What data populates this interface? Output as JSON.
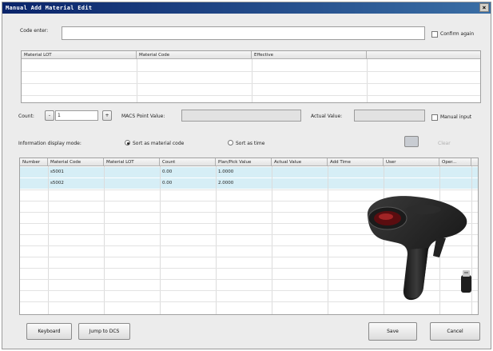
{
  "window": {
    "title": "Manual Add Material Edit",
    "close_glyph": "×"
  },
  "code_entry": {
    "label": "Code enter:",
    "value": "",
    "confirm_label": "Confirm again"
  },
  "top_table": {
    "columns": [
      "Material LOT",
      "Material Code",
      "Effective",
      ""
    ]
  },
  "count": {
    "label": "Count:",
    "minus": "-",
    "value": "1",
    "plus": "+"
  },
  "macs": {
    "label": "MACS Point Value:",
    "value": ""
  },
  "actual": {
    "label": "Actual Value:",
    "value": "",
    "manual_label": "Manual input"
  },
  "display_mode": {
    "label": "Information display mode:",
    "options": [
      "Sort as material code",
      "Sort as time"
    ],
    "selected": 0,
    "clear_label": "Clear"
  },
  "main_table": {
    "columns": [
      "Number",
      "Material Code",
      "Material LOT",
      "Count",
      "Plan/Pick Value",
      "Actual Value",
      "Add Time",
      "User",
      "Oper..."
    ],
    "rows": [
      [
        "",
        "s5001",
        "",
        "0.00",
        "1.0000",
        "",
        "",
        "",
        ""
      ],
      [
        "",
        "s5002",
        "",
        "0.00",
        "2.0000",
        "",
        "",
        "",
        ""
      ]
    ]
  },
  "buttons": {
    "keyboard": "Keyboard",
    "jump": "Jump to DCS",
    "save": "Save",
    "cancel": "Cancel"
  },
  "colors": {
    "selected_row": "#d6eef6",
    "titlebar": "#0a246a"
  }
}
